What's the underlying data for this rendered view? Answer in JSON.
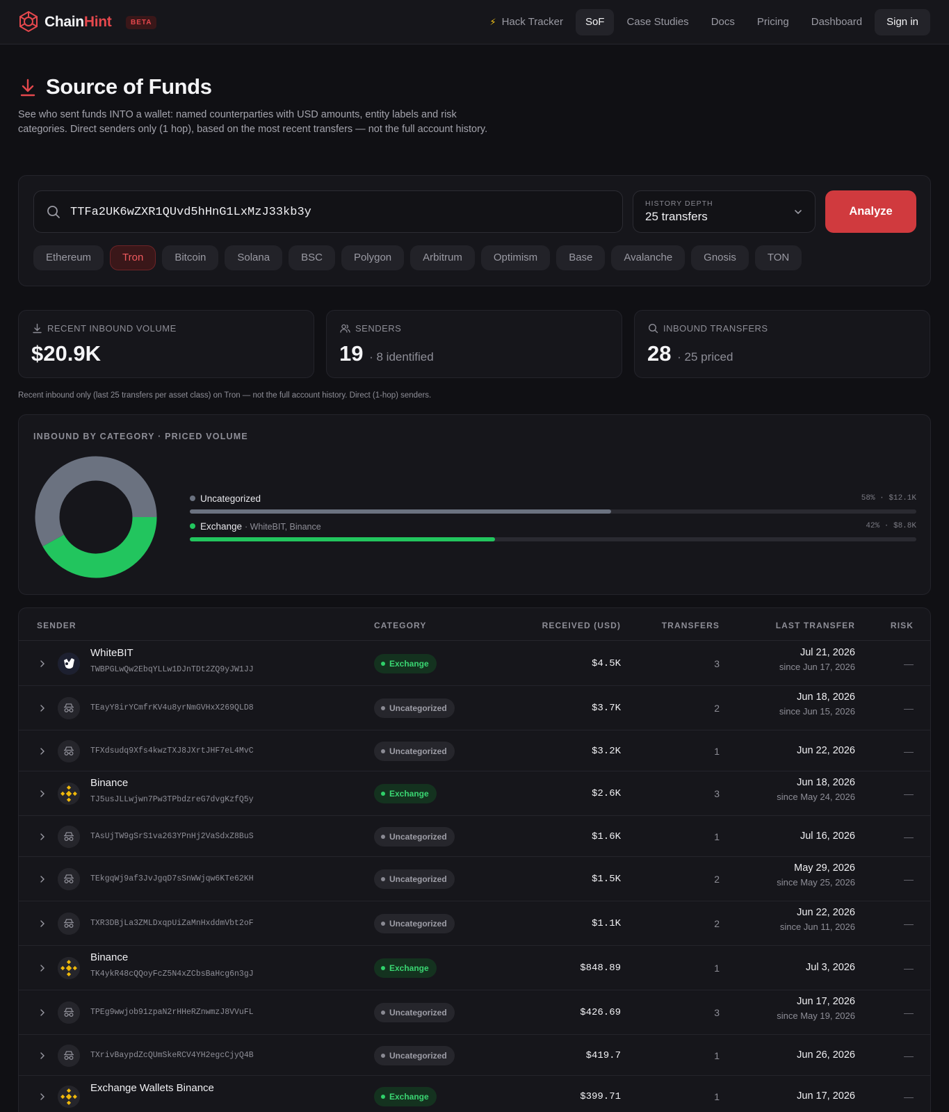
{
  "brand": {
    "name_a": "Chain",
    "name_b": "Hint",
    "badge": "BETA"
  },
  "nav": {
    "links": [
      "Hack Tracker",
      "SoF",
      "Case Studies",
      "Docs",
      "Pricing",
      "Dashboard"
    ],
    "signin": "Sign in",
    "active": "SoF",
    "bolt": "⚡"
  },
  "header": {
    "title": "Source of Funds",
    "description": "See who sent funds INTO a wallet: named counterparties with USD amounts, entity labels and risk categories. Direct senders only (1 hop), based on the most recent transfers — not the full account history."
  },
  "search": {
    "value": "TTFa2UK6wZXR1QUvd5hHnG1LxMzJ33kb3y",
    "depth_label": "HISTORY DEPTH",
    "depth_value": "25 transfers",
    "analyze_label": "Analyze",
    "chains": [
      "Ethereum",
      "Tron",
      "Bitcoin",
      "Solana",
      "BSC",
      "Polygon",
      "Arbitrum",
      "Optimism",
      "Base",
      "Avalanche",
      "Gnosis",
      "TON"
    ],
    "active_chain": "Tron"
  },
  "stats": {
    "volume": {
      "label": "RECENT INBOUND VOLUME",
      "value": "$20.9K"
    },
    "senders": {
      "label": "SENDERS",
      "value": "19",
      "sub": "· 8 identified"
    },
    "transfers": {
      "label": "INBOUND TRANSFERS",
      "value": "28",
      "sub": "· 25 priced"
    }
  },
  "note": "Recent inbound only (last 25 transfers per asset class) on Tron — not the full account history. Direct (1-hop) senders.",
  "categories": {
    "title": "INBOUND BY CATEGORY · PRICED VOLUME",
    "items": [
      {
        "name": "Uncategorized",
        "note": "",
        "pct_text": "58% · $12.1K",
        "share": 0.58,
        "color": "#6b7280"
      },
      {
        "name": "Exchange",
        "note": "· WhiteBIT, Binance",
        "pct_text": "42% · $8.8K",
        "share": 0.42,
        "color": "#22c55e"
      }
    ]
  },
  "table": {
    "headers": {
      "sender": "SENDER",
      "category": "CATEGORY",
      "received": "RECEIVED (USD)",
      "transfers": "TRANSFERS",
      "last": "LAST TRANSFER",
      "risk": "RISK"
    },
    "rows": [
      {
        "name": "WhiteBIT",
        "address": "TWBPGLwQw2EbqYLLw1DJnTDt2ZQ9yJW1JJ",
        "category": "Exchange",
        "amount": "$4.5K",
        "transfers": "3",
        "last": "Jul 21, 2026",
        "since": "since Jun 17, 2026",
        "risk": "—",
        "avatar": "whitebit-logo-icon"
      },
      {
        "name": "",
        "address": "TEayY8irYCmfrKV4u8yrNmGVHxX269QLD8",
        "category": "Uncategorized",
        "amount": "$3.7K",
        "transfers": "2",
        "last": "Jun 18, 2026",
        "since": "since Jun 15, 2026",
        "risk": "—",
        "avatar": "incognito-icon"
      },
      {
        "name": "",
        "address": "TFXdsudq9Xfs4kwzTXJ8JXrtJHF7eL4MvC",
        "category": "Uncategorized",
        "amount": "$3.2K",
        "transfers": "1",
        "last": "Jun 22, 2026",
        "since": "",
        "risk": "—",
        "avatar": "incognito-icon"
      },
      {
        "name": "Binance",
        "address": "TJ5usJLLwjwn7Pw3TPbdzreG7dvgKzfQ5y",
        "category": "Exchange",
        "amount": "$2.6K",
        "transfers": "3",
        "last": "Jun 18, 2026",
        "since": "since May 24, 2026",
        "risk": "—",
        "avatar": "binance-logo-icon"
      },
      {
        "name": "",
        "address": "TAsUjTW9gSrS1va263YPnHj2VaSdxZ8BuS",
        "category": "Uncategorized",
        "amount": "$1.6K",
        "transfers": "1",
        "last": "Jul 16, 2026",
        "since": "",
        "risk": "—",
        "avatar": "incognito-icon"
      },
      {
        "name": "",
        "address": "TEkgqWj9af3JvJgqD7sSnWWjqw6KTe62KH",
        "category": "Uncategorized",
        "amount": "$1.5K",
        "transfers": "2",
        "last": "May 29, 2026",
        "since": "since May 25, 2026",
        "risk": "—",
        "avatar": "incognito-icon"
      },
      {
        "name": "",
        "address": "TXR3DBjLa3ZMLDxqpUiZaMnHxddmVbt2oF",
        "category": "Uncategorized",
        "amount": "$1.1K",
        "transfers": "2",
        "last": "Jun 22, 2026",
        "since": "since Jun 11, 2026",
        "risk": "—",
        "avatar": "incognito-icon"
      },
      {
        "name": "Binance",
        "address": "TK4ykR48cQQoyFcZ5N4xZCbsBaHcg6n3gJ",
        "category": "Exchange",
        "amount": "$848.89",
        "transfers": "1",
        "last": "Jul 3, 2026",
        "since": "",
        "risk": "—",
        "avatar": "binance-logo-icon"
      },
      {
        "name": "",
        "address": "TPEg9wwjob91zpaN2rHHeRZnwmzJ8VVuFL",
        "category": "Uncategorized",
        "amount": "$426.69",
        "transfers": "3",
        "last": "Jun 17, 2026",
        "since": "since May 19, 2026",
        "risk": "—",
        "avatar": "incognito-icon"
      },
      {
        "name": "",
        "address": "TXrivBaypdZcQUmSkeRCV4YH2egcCjyQ4B",
        "category": "Uncategorized",
        "amount": "$419.7",
        "transfers": "1",
        "last": "Jun 26, 2026",
        "since": "",
        "risk": "—",
        "avatar": "incognito-icon"
      },
      {
        "name": "Exchange Wallets Binance",
        "address": "",
        "category": "Exchange",
        "amount": "$399.71",
        "transfers": "1",
        "last": "Jun 17, 2026",
        "since": "",
        "risk": "—",
        "avatar": "binance-logo-icon"
      }
    ]
  }
}
